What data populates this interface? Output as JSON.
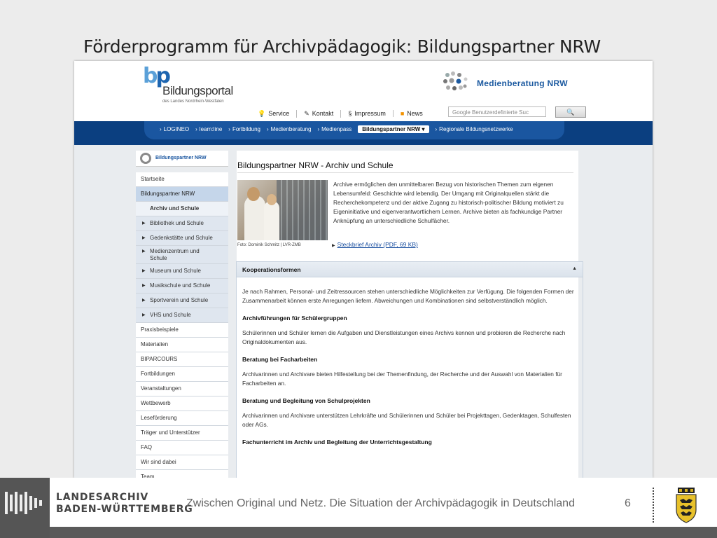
{
  "slide": {
    "title": "Förderprogramm für Archivpädagogik: Bildungspartner NRW"
  },
  "site": {
    "bp_logo": {
      "mark_b": "b",
      "mark_p": "p",
      "name": "Bildungsportal",
      "subtitle": "des Landes Nordrhein-Westfalen"
    },
    "mb_logo": {
      "text": "Medienberatung NRW"
    },
    "util_nav": [
      {
        "icon": "lightbulb-icon",
        "label": "Service"
      },
      {
        "icon": "pencil-icon",
        "label": "Kontakt"
      },
      {
        "icon": "paragraph-icon",
        "label": "Impressum"
      },
      {
        "icon": "rss-icon",
        "label": "News"
      }
    ],
    "search": {
      "placeholder": "Google Benutzerdefinierte Suc",
      "button": "🔍"
    },
    "main_nav": [
      {
        "label": "LOGINEO"
      },
      {
        "label": "learn:line"
      },
      {
        "label": "Fortbildung"
      },
      {
        "label": "Medienberatung"
      },
      {
        "label": "Medienpass"
      },
      {
        "label": "Bildungspartner NRW",
        "active": true
      },
      {
        "label": "Regionale Bildungsnetzwerke"
      }
    ],
    "sidebar": {
      "logo_text": "Bildungspartner NRW",
      "items": [
        {
          "label": "Startseite"
        },
        {
          "label": "Bildungspartner NRW"
        },
        {
          "label": "Archiv und Schule"
        },
        {
          "label": "Bibliothek und Schule"
        },
        {
          "label": "Gedenkstätte und Schule"
        },
        {
          "label": "Medienzentrum und",
          "label2": "Schule"
        },
        {
          "label": "Museum und Schule"
        },
        {
          "label": "Musikschule und Schule"
        },
        {
          "label": "Sportverein und Schule"
        },
        {
          "label": "VHS und Schule"
        },
        {
          "label": "Praxisbeispiele"
        },
        {
          "label": "Materialien"
        },
        {
          "label": "BIPARCOURS"
        },
        {
          "label": "Fortbildungen"
        },
        {
          "label": "Veranstaltungen"
        },
        {
          "label": "Wettbewerb"
        },
        {
          "label": "Leseförderung"
        },
        {
          "label": "Träger und Unterstützer"
        },
        {
          "label": "FAQ"
        },
        {
          "label": "Wir sind dabei"
        },
        {
          "label": "Team"
        }
      ]
    },
    "content": {
      "title": "Bildungspartner NRW - Archiv und Schule",
      "photo_caption": "Foto: Dominik Schmitz | LVR-ZMB",
      "intro": "Archive ermöglichen den unmittelbaren Bezug von historischen Themen zum eigenen Lebensumfeld: Geschichte wird lebendig. Der Umgang mit Originalquellen stärkt die Recherchekompetenz und der aktive Zugang zu historisch-politischer Bildung motiviert zu Eigeninitiative und eigenverantwortlichem Lernen. Archive bieten als fachkundige Partner Anknüpfung an unterschiedliche Schulfächer.",
      "download_link": "Steckbrief Archiv (PDF, 69 KB)",
      "accordion": {
        "title": "Kooperationsformen",
        "intro": "Je nach Rahmen, Personal- und Zeitressourcen stehen unterschiedliche Möglichkeiten zur Verfügung. Die folgenden Formen der Zusammenarbeit können erste Anregungen liefern. Abweichungen und Kombinationen sind selbstverständlich möglich.",
        "sections": [
          {
            "heading": "Archivführungen für Schülergruppen",
            "text": "Schülerinnen und Schüler lernen die Aufgaben und Dienstleistungen eines Archivs kennen und probieren die Recherche nach Originaldokumenten aus."
          },
          {
            "heading": "Beratung bei Facharbeiten",
            "text": "Archivarinnen und Archivare bieten Hilfestellung bei der Themenfindung, der Recherche und der Auswahl von Materialien für Facharbeiten an."
          },
          {
            "heading": "Beratung und Begleitung von Schulprojekten",
            "text": "Archivarinnen und Archivare unterstützen Lehrkräfte und Schülerinnen und Schüler bei Projekttagen, Gedenktagen, Schulfesten oder AGs."
          },
          {
            "heading": "Fachunterricht im Archiv und Begleitung der Unterrichtsgestaltung",
            "text": ""
          }
        ]
      }
    }
  },
  "footer": {
    "archive_line1": "LANDESARCHIV",
    "archive_line2": "BADEN-WÜRTTEMBERG",
    "text": "Zwischen Original und Netz. Die Situation der Archivpädagogik in Deutschland",
    "page": "6"
  },
  "colors": {
    "nav_dark": "#0b3f80",
    "nav_blue": "#1a56a0",
    "link": "#1a4fa0",
    "sidebar_active": "#c5d6ea",
    "footer_gray": "#555555"
  }
}
